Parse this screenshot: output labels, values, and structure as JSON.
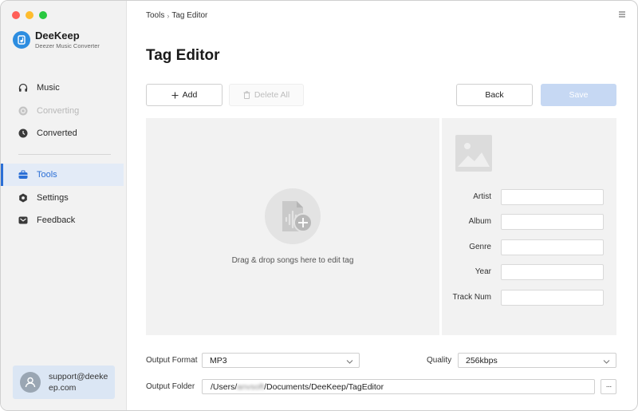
{
  "app": {
    "name": "DeeKeep",
    "subtitle": "Deezer Music Converter"
  },
  "sidebar": {
    "items": [
      {
        "label": "Music",
        "icon": "headphones-icon",
        "state": "normal"
      },
      {
        "label": "Converting",
        "icon": "converting-icon",
        "state": "disabled"
      },
      {
        "label": "Converted",
        "icon": "clock-icon",
        "state": "normal"
      },
      {
        "label": "Tools",
        "icon": "toolbox-icon",
        "state": "active"
      },
      {
        "label": "Settings",
        "icon": "gear-icon",
        "state": "normal"
      },
      {
        "label": "Feedback",
        "icon": "mail-icon",
        "state": "normal"
      }
    ],
    "support_email": "support@deekeep.com"
  },
  "breadcrumb": {
    "parent": "Tools",
    "current": "Tag Editor"
  },
  "page": {
    "title": "Tag Editor"
  },
  "toolbar": {
    "add_label": "Add",
    "delete_all_label": "Delete All",
    "back_label": "Back",
    "save_label": "Save"
  },
  "drop_zone": {
    "text": "Drag & drop songs here to edit tag"
  },
  "tags": {
    "fields": [
      {
        "label": "Artist",
        "value": ""
      },
      {
        "label": "Album",
        "value": ""
      },
      {
        "label": "Genre",
        "value": ""
      },
      {
        "label": "Year",
        "value": ""
      },
      {
        "label": "Track Num",
        "value": ""
      }
    ]
  },
  "output": {
    "format_label": "Output Format",
    "format_value": "MP3",
    "quality_label": "Quality",
    "quality_value": "256kbps",
    "folder_label": "Output Folder",
    "folder_prefix": "/Users/",
    "folder_user_redacted": "anvsoft",
    "folder_suffix": "/Documents/DeeKeep/TagEditor",
    "browse_label": "···"
  },
  "colors": {
    "accent": "#2b6fd6",
    "active_bg": "#e3ebf7",
    "save_disabled": "#c6d8f3",
    "panel_bg": "#f2f2f2",
    "logo": "#2d8de0",
    "traffic_red": "#ff5f57",
    "traffic_yellow": "#febc2e",
    "traffic_green": "#28c840"
  }
}
